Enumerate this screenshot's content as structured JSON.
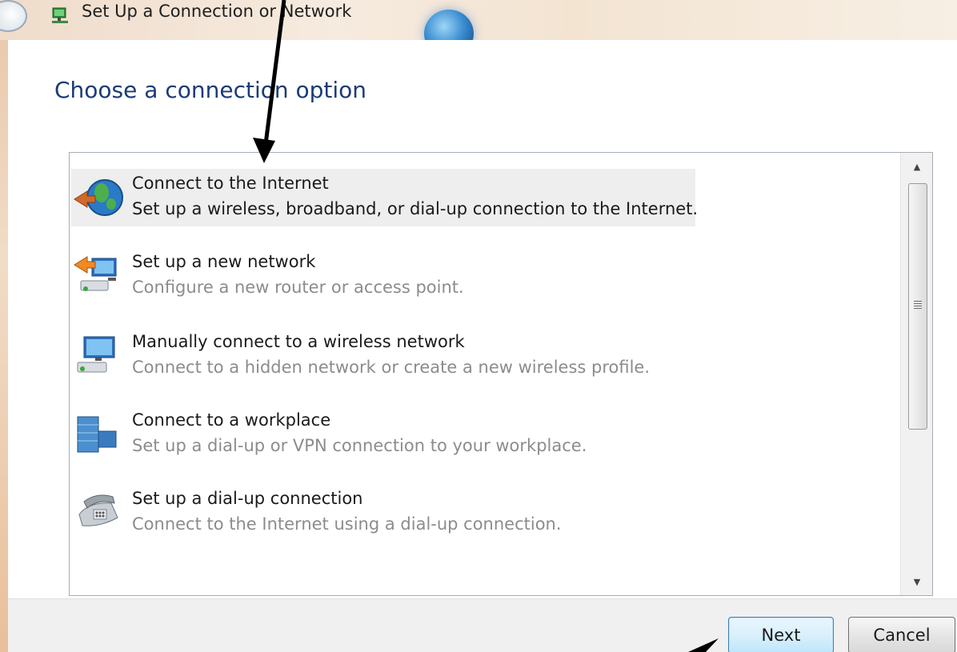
{
  "window": {
    "title": "Set Up a Connection or Network"
  },
  "main": {
    "heading": "Choose a connection option"
  },
  "options": [
    {
      "title": "Connect to the Internet",
      "description": "Set up a wireless, broadband, or dial-up connection to the Internet.",
      "icon": "globe-network-icon",
      "selected": true
    },
    {
      "title": "Set up a new network",
      "description": "Configure a new router or access point.",
      "icon": "new-network-icon",
      "selected": false
    },
    {
      "title": "Manually connect to a wireless network",
      "description": "Connect to a hidden network or create a new wireless profile.",
      "icon": "wireless-network-icon",
      "selected": false
    },
    {
      "title": "Connect to a workplace",
      "description": "Set up a dial-up or VPN connection to your workplace.",
      "icon": "workplace-icon",
      "selected": false
    },
    {
      "title": "Set up a dial-up connection",
      "description": "Connect to the Internet using a dial-up connection.",
      "icon": "dialup-phone-icon",
      "selected": false
    }
  ],
  "footer": {
    "next_label": "Next",
    "cancel_label": "Cancel"
  },
  "colors": {
    "heading": "#1b3b78",
    "selection": "#eeeeee",
    "next_border": "#3c7fb1"
  }
}
